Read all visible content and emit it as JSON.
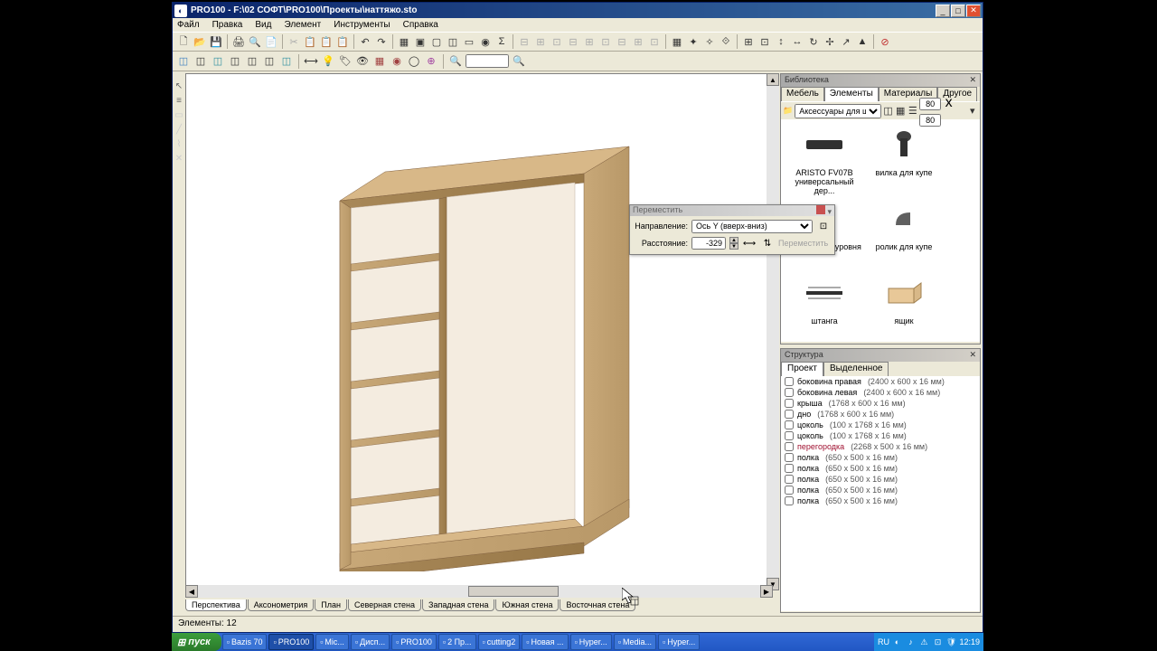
{
  "window": {
    "app_name": "PRO100",
    "title": "PRO100 - F:\\02 СОФТ\\PRO100\\Проекты\\наттяжо.sto"
  },
  "menu": [
    "Файл",
    "Правка",
    "Вид",
    "Элемент",
    "Инструменты",
    "Справка"
  ],
  "view_tabs": [
    "Перспектива",
    "Аксонометрия",
    "План",
    "Северная стена",
    "Западная стена",
    "Южная стена",
    "Восточная стена"
  ],
  "active_view_tab": 0,
  "statusbar": "Элементы: 12",
  "library_panel": {
    "title": "Библиотека",
    "tabs": [
      "Мебель",
      "Элементы",
      "Материалы",
      "Другое"
    ],
    "active_tab": 1,
    "folder_label": "Аксессуары для шкафа",
    "size_w": "80",
    "size_h": "80",
    "items": [
      {
        "name": "ARISTO FV07B универсальный дер...",
        "thumb": "rail"
      },
      {
        "name": "вилка для купе",
        "thumb": "plug"
      },
      {
        "name": "для обуви 3-уровня",
        "thumb": "shoe"
      },
      {
        "name": "ролик для купе",
        "thumb": "roller"
      },
      {
        "name": "штанга",
        "thumb": "rod"
      },
      {
        "name": "ящик",
        "thumb": "drawer"
      }
    ]
  },
  "structure_panel": {
    "title": "Структура",
    "tabs": [
      "Проект",
      "Выделенное"
    ],
    "active_tab": 0,
    "rows": [
      {
        "name": "боковина правая",
        "dims": "(2400 x 600 x 16 мм)",
        "hl": false
      },
      {
        "name": "боковина левая",
        "dims": "(2400 x 600 x 16 мм)",
        "hl": false
      },
      {
        "name": "крыша",
        "dims": "(1768 x 600 x 16 мм)",
        "hl": false
      },
      {
        "name": "дно",
        "dims": "(1768 x 600 x 16 мм)",
        "hl": false
      },
      {
        "name": "цоколь",
        "dims": "(100 x 1768 x 16 мм)",
        "hl": false
      },
      {
        "name": "цоколь",
        "dims": "(100 x 1768 x 16 мм)",
        "hl": false
      },
      {
        "name": "перегородка",
        "dims": "(2268 x 500 x 16 мм)",
        "hl": true
      },
      {
        "name": "полка",
        "dims": "(650 x 500 x 16 мм)",
        "hl": false
      },
      {
        "name": "полка",
        "dims": "(650 x 500 x 16 мм)",
        "hl": false
      },
      {
        "name": "полка",
        "dims": "(650 x 500 x 16 мм)",
        "hl": false
      },
      {
        "name": "полка",
        "dims": "(650 x 500 x 16 мм)",
        "hl": false
      },
      {
        "name": "полка",
        "dims": "(650 x 500 x 16 мм)",
        "hl": false
      }
    ]
  },
  "move_dialog": {
    "title": "Переместить",
    "direction_label": "Направление:",
    "direction_value": "Ось Y (вверх-вниз)",
    "distance_label": "Расстояние:",
    "distance_value": "-329",
    "go_label": "Переместить"
  },
  "taskbar": {
    "start": "пуск",
    "items": [
      {
        "label": "Bazis 70"
      },
      {
        "label": "PRO100",
        "active": true
      },
      {
        "label": "Mic..."
      },
      {
        "label": "Дисп..."
      },
      {
        "label": "PRO100"
      },
      {
        "label": "2 Пр..."
      },
      {
        "label": "cutting2"
      },
      {
        "label": "Новая ..."
      },
      {
        "label": "Hyper..."
      },
      {
        "label": "Media..."
      },
      {
        "label": "Hyper..."
      }
    ],
    "lang": "RU",
    "time": "12:19"
  }
}
